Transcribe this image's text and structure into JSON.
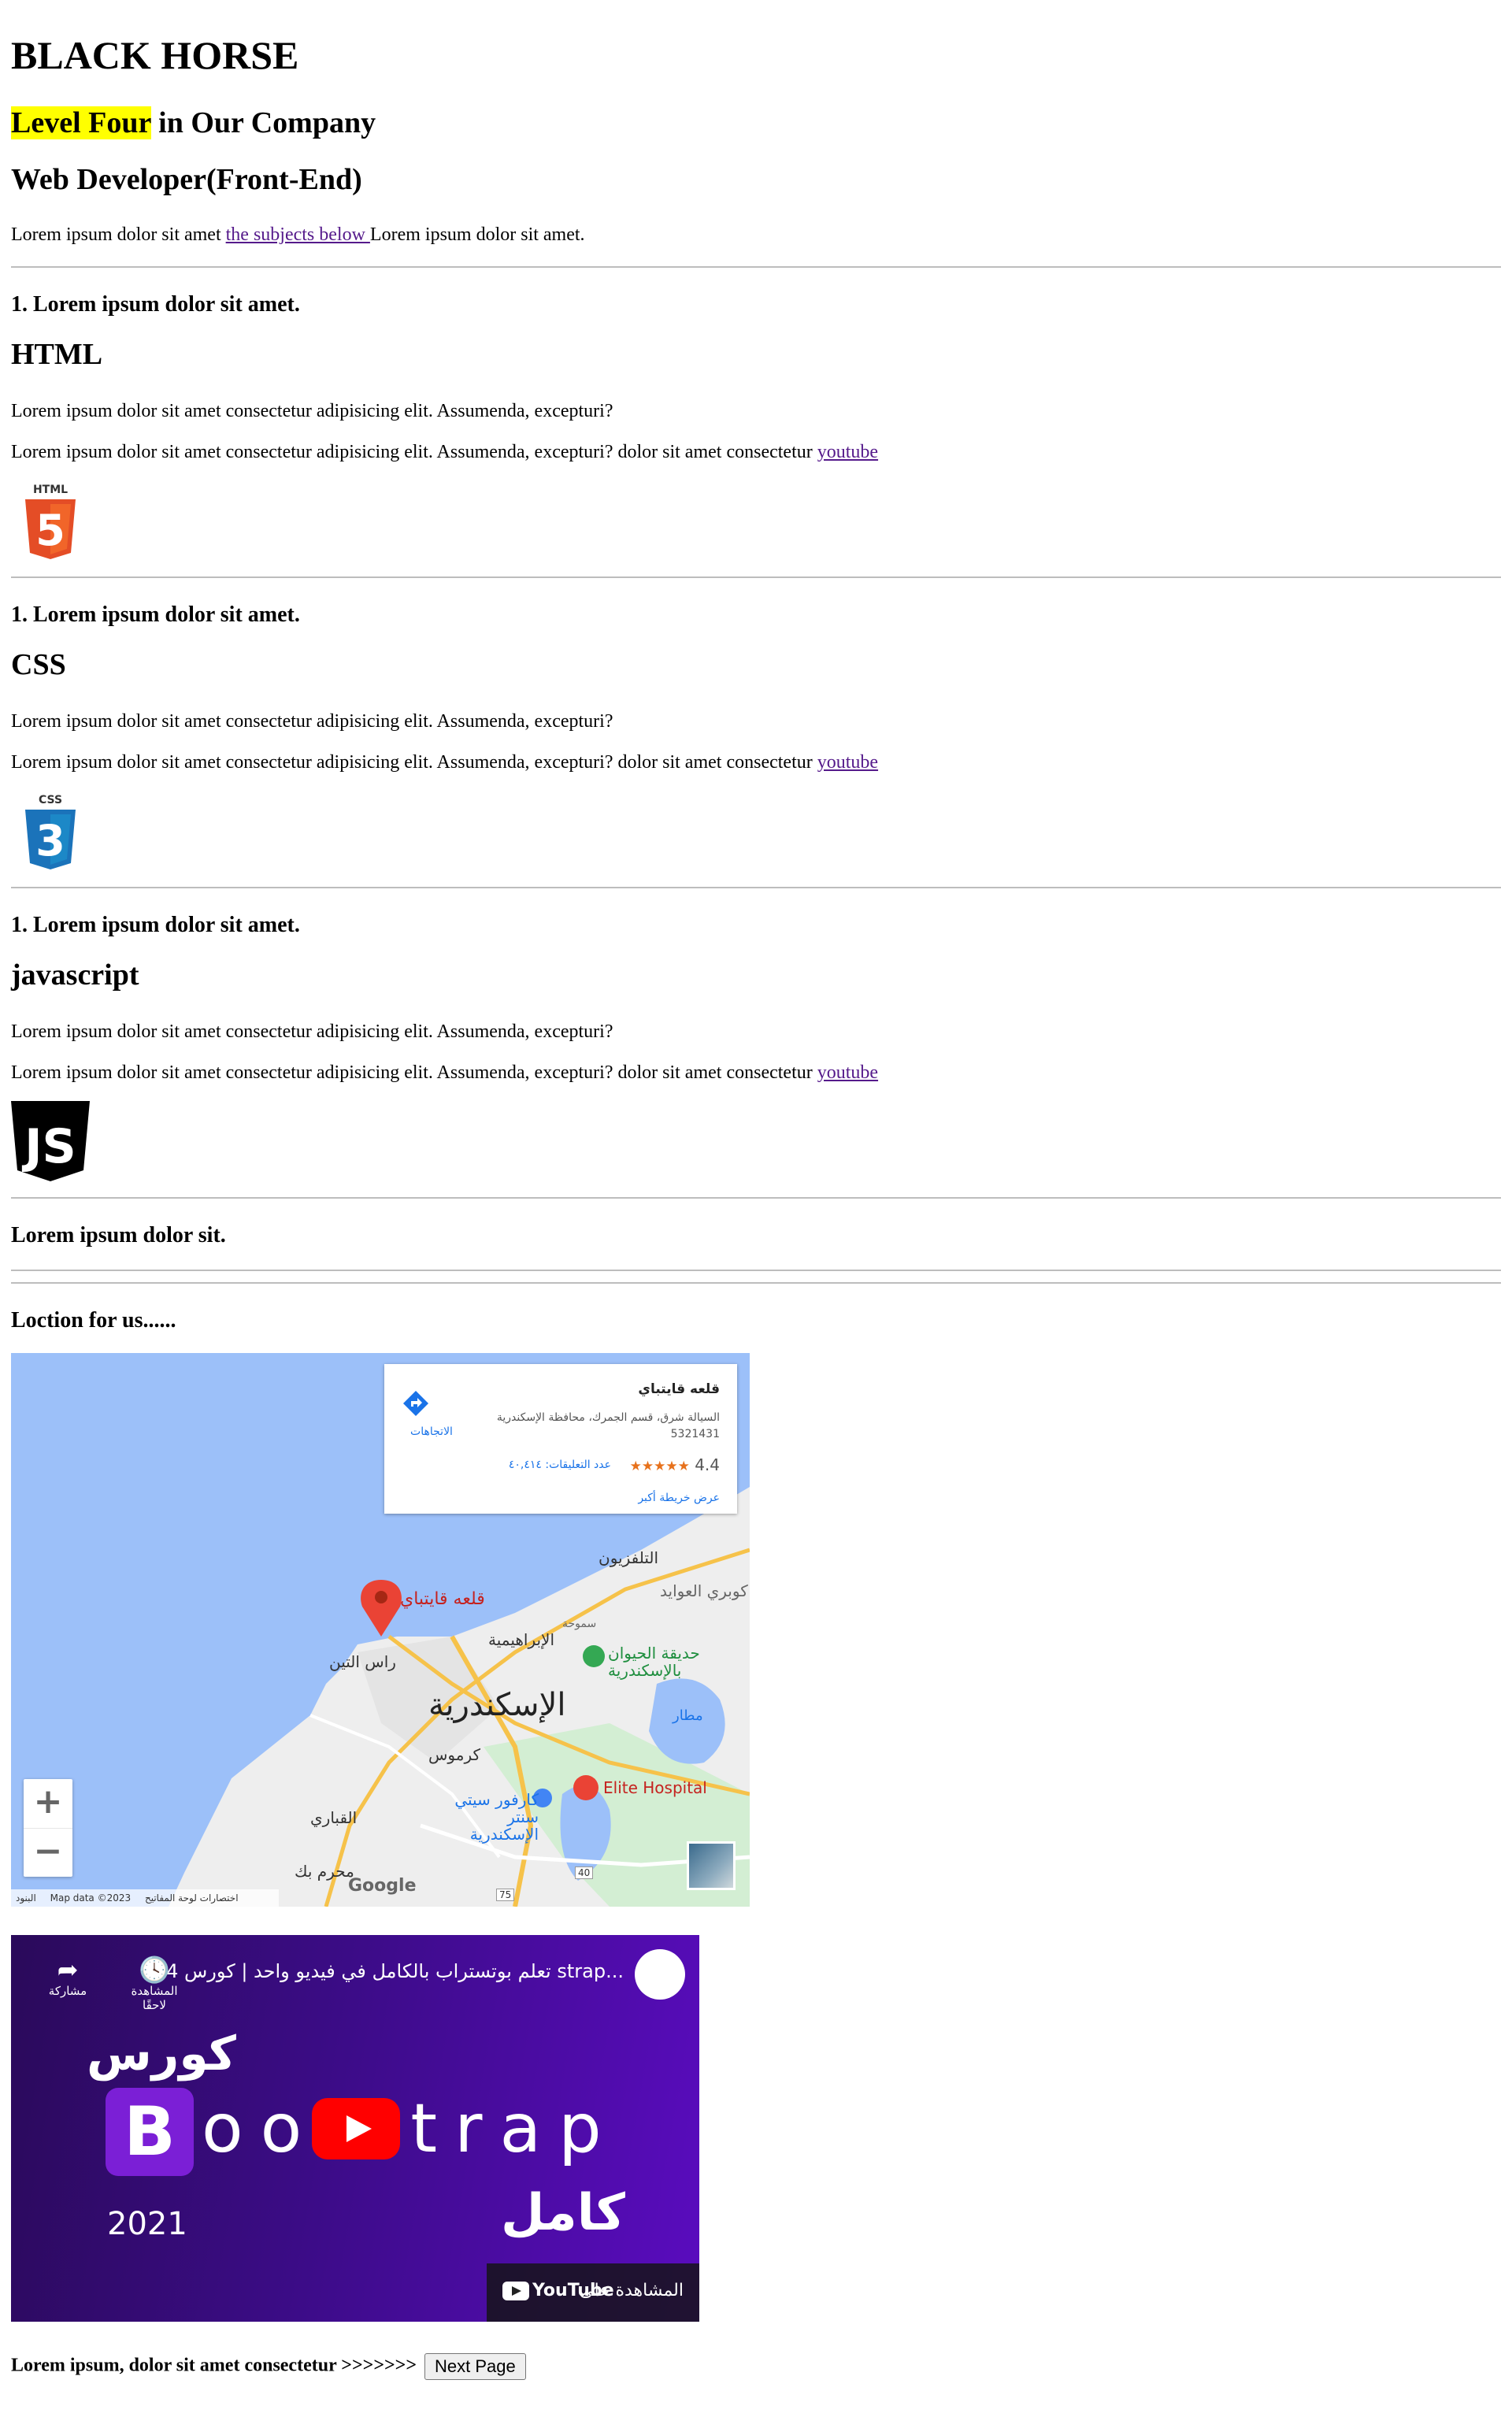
{
  "header": {
    "title": "BLACK HORSE",
    "subtitle_highlight": "Level Four",
    "subtitle_rest": " in Our Company",
    "role": "Web Developer(Front-End)",
    "intro_before": "Lorem ipsum dolor sit amet ",
    "intro_link": "the subjects below ",
    "intro_after": "Lorem ipsum dolor sit amet."
  },
  "sections": [
    {
      "kicker": "1. Lorem ipsum dolor sit amet.",
      "title": "HTML",
      "para1": "Lorem ipsum dolor sit amet consectetur adipisicing elit. Assumenda, excepturi?",
      "para2": "Lorem ipsum dolor sit amet consectetur adipisicing elit. Assumenda, excepturi? dolor sit amet consectetur ",
      "link": "youtube",
      "logo_text": "HTML",
      "logo_number": "5",
      "logo_color": "#e44d26"
    },
    {
      "kicker": "1. Lorem ipsum dolor sit amet.",
      "title": "CSS",
      "para1": "Lorem ipsum dolor sit amet consectetur adipisicing elit. Assumenda, excepturi?",
      "para2": "Lorem ipsum dolor sit amet consectetur adipisicing elit. Assumenda, excepturi? dolor sit amet consectetur ",
      "link": "youtube",
      "logo_text": "CSS",
      "logo_number": "3",
      "logo_color": "#1b73ba"
    },
    {
      "kicker": "1. Lorem ipsum dolor sit amet.",
      "title": "javascript",
      "para1": "Lorem ipsum dolor sit amet consectetur adipisicing elit. Assumenda, excepturi?",
      "para2": "Lorem ipsum dolor sit amet consectetur adipisicing elit. Assumenda, excepturi? dolor sit amet consectetur ",
      "link": "youtube",
      "logo_text": "JS",
      "logo_color": "#000000"
    }
  ],
  "extra_heading": "Lorem ipsum dolor sit.",
  "location_heading": "Loction for us......",
  "map": {
    "place_name": "قلعه قايتباي",
    "address": "السيالة شرق، قسم الجمرك، محافظة الإسكندرية 5321431",
    "rating": "4.4",
    "stars": "★★★★★",
    "reviews": "عدد التعليقات: ٤٠,٤١٤",
    "view_larger": "عرض خريطة أكبر",
    "directions": "الاتجاهات",
    "labels": {
      "city": "الإسكندرية",
      "pin": "قلعه قايتباي",
      "ras_el_tin": "راس التين",
      "ibrahimiya": "الإبراهيمية",
      "zoo": "حديقة الحيوان بالإسكندرية",
      "hospital": "Elite Hospital",
      "karmouz": "كرموس",
      "carrefour": "كارفور سيتي سنتر الإسكندرية",
      "fakhry": "القباري",
      "mahmoudiya": "محرم بك",
      "stanley": "كوبري العوايد",
      "telefron": "التلفزيون",
      "sumouha": "سموحة",
      "airport": "مطار",
      "road40": "40",
      "road75": "75"
    },
    "zoom_in": "+",
    "zoom_out": "−",
    "footer_terms": "البنود",
    "footer_data": "Map data ©2023",
    "footer_shortcuts": "اختصارات لوحة المفاتيح",
    "google": "Google"
  },
  "video": {
    "title": "تعلم بوتستراب بالكامل في فيديو واحد | كورس 4 strap...",
    "watch_later": "المشاهدة لاحقًا",
    "share": "مشاركة",
    "course": "كورس",
    "bootstrap_letter": "B",
    "bootstrap_rest": "oo strap",
    "year": "2021",
    "complete": "كامل",
    "watch_on": "المشاهدة على",
    "youtube": "YouTube"
  },
  "footer": {
    "text": "Lorem ipsum, dolor sit amet consectetur >>>>>>> ",
    "next_button": "Next Page"
  }
}
